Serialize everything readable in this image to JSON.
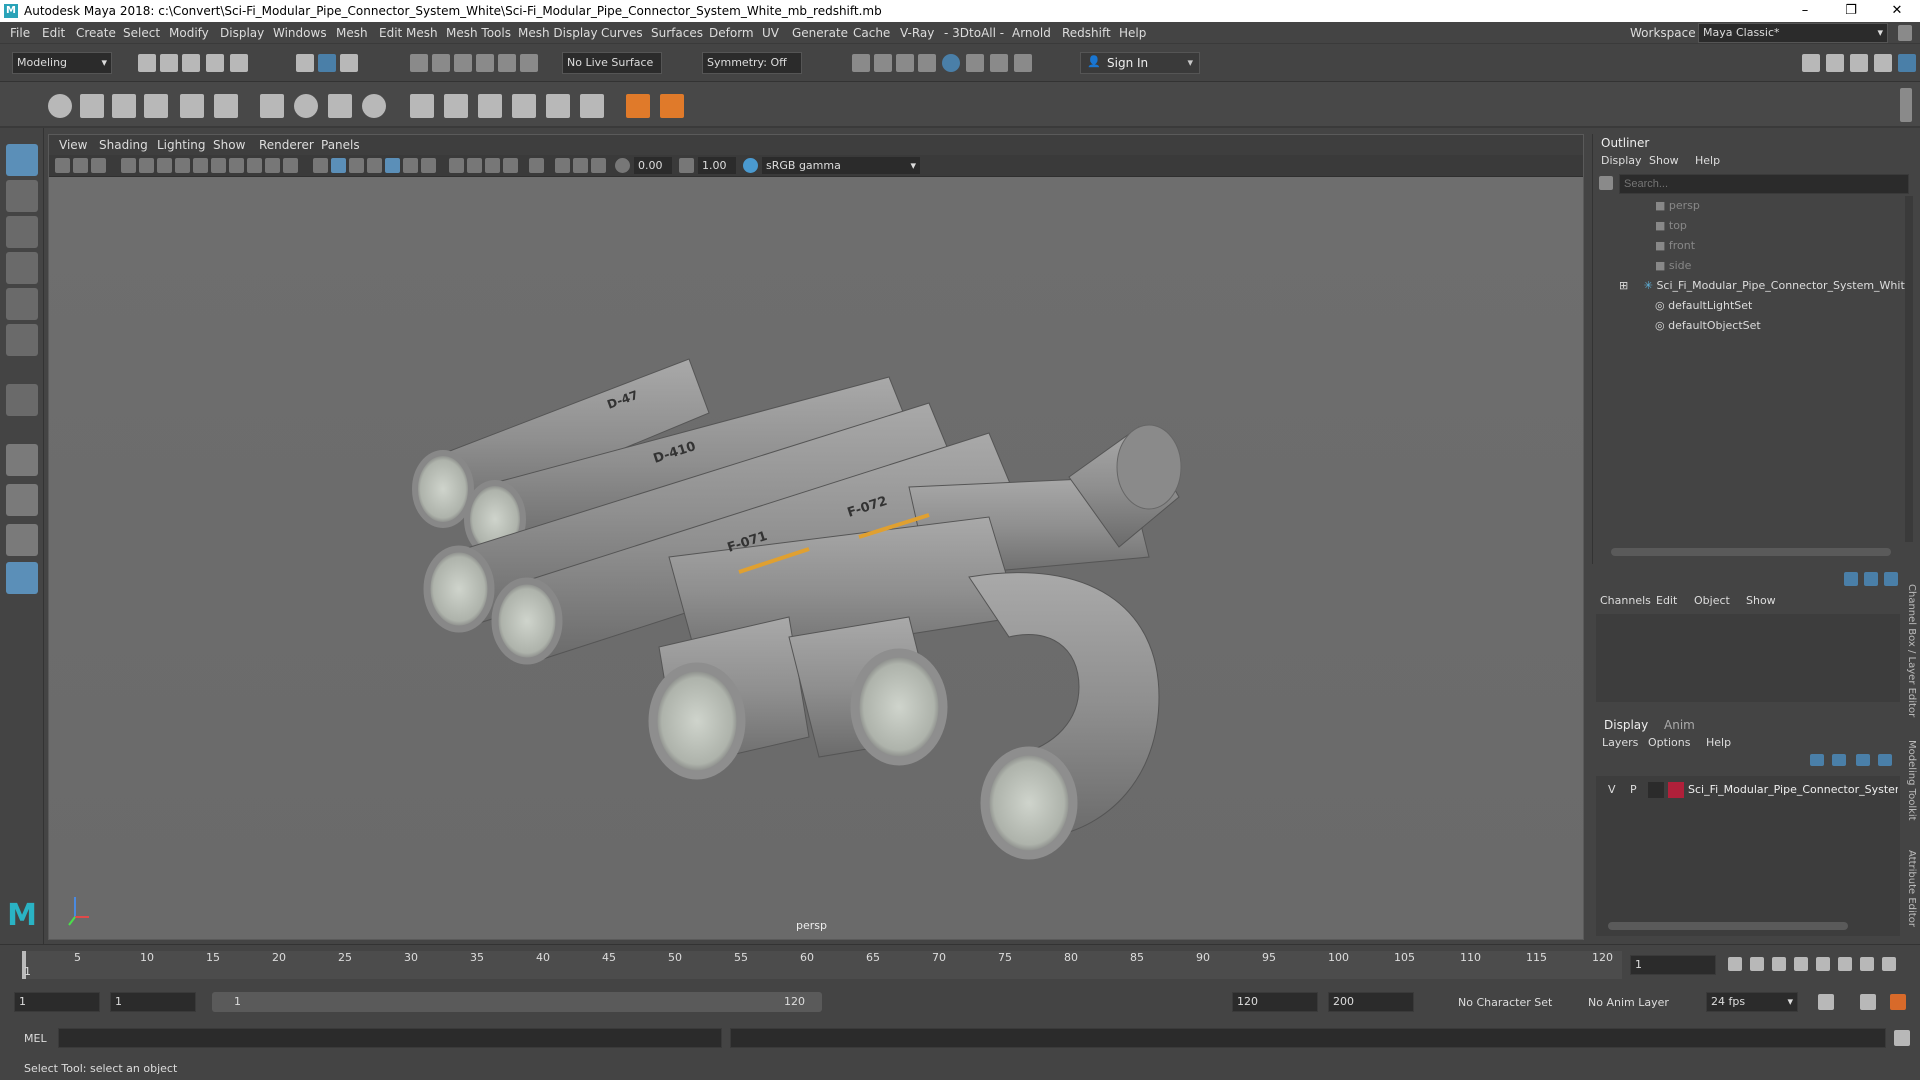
{
  "window": {
    "title": "Autodesk Maya 2018: c:\\Convert\\Sci-Fi_Modular_Pipe_Connector_System_White\\Sci-Fi_Modular_Pipe_Connector_System_White_mb_redshift.mb",
    "minimize": "–",
    "maximize": "❐",
    "close": "✕"
  },
  "menu": [
    "File",
    "Edit",
    "Create",
    "Select",
    "Modify",
    "Display",
    "Windows",
    "Mesh",
    "Edit Mesh",
    "Mesh Tools",
    "Mesh Display",
    "Curves",
    "Surfaces",
    "Deform",
    "UV",
    "Generate",
    "Cache",
    "V-Ray",
    "- 3DtoAll -",
    "Arnold",
    "Redshift",
    "Help"
  ],
  "workspace": {
    "label": "Workspace :",
    "value": "Maya Classic*"
  },
  "status": {
    "mode": "Modeling",
    "live_surface": "No Live Surface",
    "symmetry": "Symmetry: Off",
    "sign_in": "Sign In"
  },
  "viewport": {
    "menu": [
      "View",
      "Shading",
      "Lighting",
      "Show",
      "Renderer",
      "Panels"
    ],
    "exposure": "0.00",
    "gamma": "1.00",
    "color_space": "sRGB gamma",
    "camera_label": "persp"
  },
  "outliner": {
    "title": "Outliner",
    "menu": [
      "Display",
      "Show",
      "Help"
    ],
    "search_placeholder": "Search...",
    "items": [
      {
        "label": "persp",
        "dim": true,
        "icon": "camera-icon"
      },
      {
        "label": "top",
        "dim": true,
        "icon": "camera-icon"
      },
      {
        "label": "front",
        "dim": true,
        "icon": "camera-icon"
      },
      {
        "label": "side",
        "dim": true,
        "icon": "camera-icon"
      },
      {
        "label": "Sci_Fi_Modular_Pipe_Connector_System_White_ncl",
        "dim": false,
        "icon": "group-icon"
      },
      {
        "label": "defaultLightSet",
        "dim": false,
        "icon": "set-icon"
      },
      {
        "label": "defaultObjectSet",
        "dim": false,
        "icon": "set-icon"
      }
    ]
  },
  "channel_box": {
    "menu": [
      "Channels",
      "Edit",
      "Object",
      "Show"
    ]
  },
  "layer_editor": {
    "tabs": [
      "Display",
      "Anim"
    ],
    "menu": [
      "Layers",
      "Options",
      "Help"
    ],
    "layer": {
      "v": "V",
      "p": "P",
      "name": "Sci_Fi_Modular_Pipe_Connector_System_",
      "color": "#b0203a"
    }
  },
  "side_tabs": [
    "Channel Box / Layer Editor",
    "Modeling Toolkit",
    "Attribute Editor"
  ],
  "timeline": {
    "ticks": [
      "5",
      "10",
      "15",
      "20",
      "25",
      "30",
      "35",
      "40",
      "45",
      "50",
      "55",
      "60",
      "65",
      "70",
      "75",
      "80",
      "85",
      "90",
      "95",
      "100",
      "105",
      "110",
      "115",
      "120"
    ],
    "current": "1",
    "current_field": "1"
  },
  "range": {
    "start": "1",
    "playback_start": "1",
    "slider_start": "1",
    "slider_end": "120",
    "playback_end": "120",
    "end": "200",
    "character_set": "No Character Set",
    "anim_layer": "No Anim Layer",
    "fps": "24 fps"
  },
  "cmdline": {
    "label": "MEL"
  },
  "helpline": "Select Tool: select an object",
  "pipe_labels": [
    "D-410",
    "D-47",
    "F-071",
    "F-072"
  ]
}
